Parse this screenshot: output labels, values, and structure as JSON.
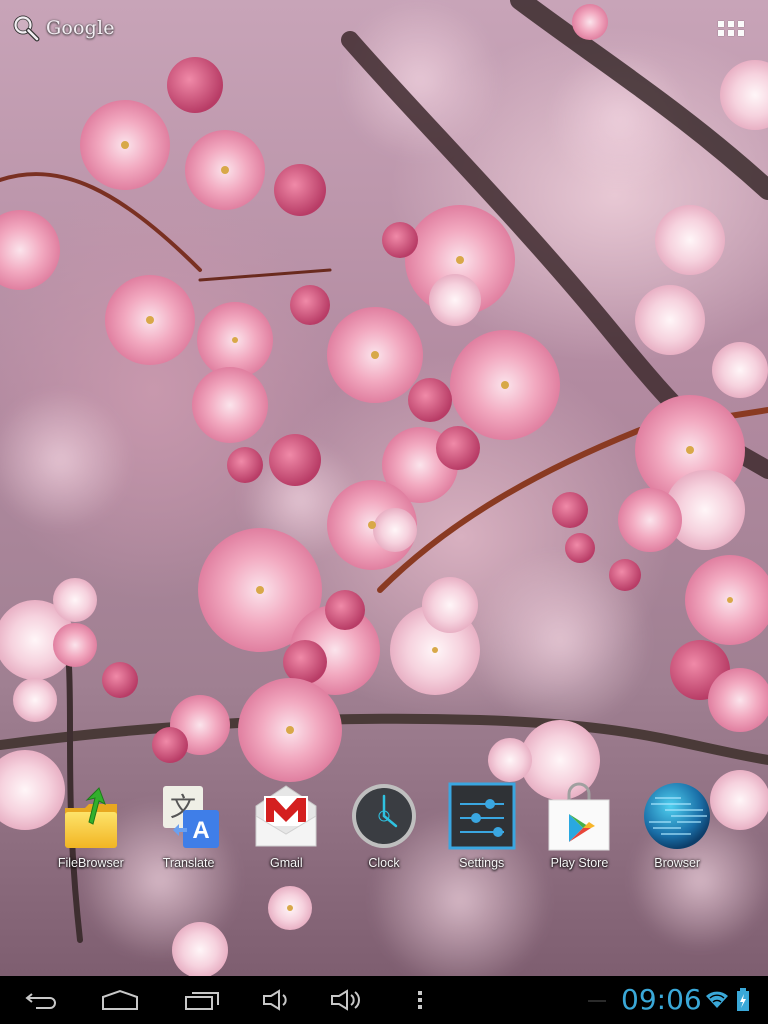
{
  "home_screen": {
    "search_widget": {
      "label": "Google",
      "icon": "search-icon"
    },
    "apps_button": {
      "icon": "apps-grid-icon"
    },
    "wallpaper": {
      "subject": "pink cherry blossoms on branches"
    },
    "dock_apps": [
      {
        "label": "FileBrowser",
        "icon": "folder-arrow-icon"
      },
      {
        "label": "Translate",
        "icon": "translate-icon"
      },
      {
        "label": "Gmail",
        "icon": "gmail-envelope-icon"
      },
      {
        "label": "Clock",
        "icon": "clock-icon"
      },
      {
        "label": "Settings",
        "icon": "settings-sliders-icon"
      },
      {
        "label": "Play Store",
        "icon": "play-store-bag-icon"
      },
      {
        "label": "Browser",
        "icon": "globe-icon"
      }
    ]
  },
  "system_bar": {
    "buttons": [
      {
        "name": "back",
        "icon": "back-icon"
      },
      {
        "name": "home",
        "icon": "home-icon"
      },
      {
        "name": "recents",
        "icon": "recent-apps-icon"
      },
      {
        "name": "volume-down",
        "icon": "volume-down-icon"
      },
      {
        "name": "volume-up",
        "icon": "volume-up-icon"
      },
      {
        "name": "menu",
        "icon": "overflow-menu-icon"
      }
    ],
    "time": "09:06",
    "status_icons": [
      "wifi-icon",
      "battery-charging-icon"
    ],
    "colors": {
      "accent": "#3aa8d8",
      "background": "#000000",
      "icon": "#c8c8c8"
    }
  }
}
